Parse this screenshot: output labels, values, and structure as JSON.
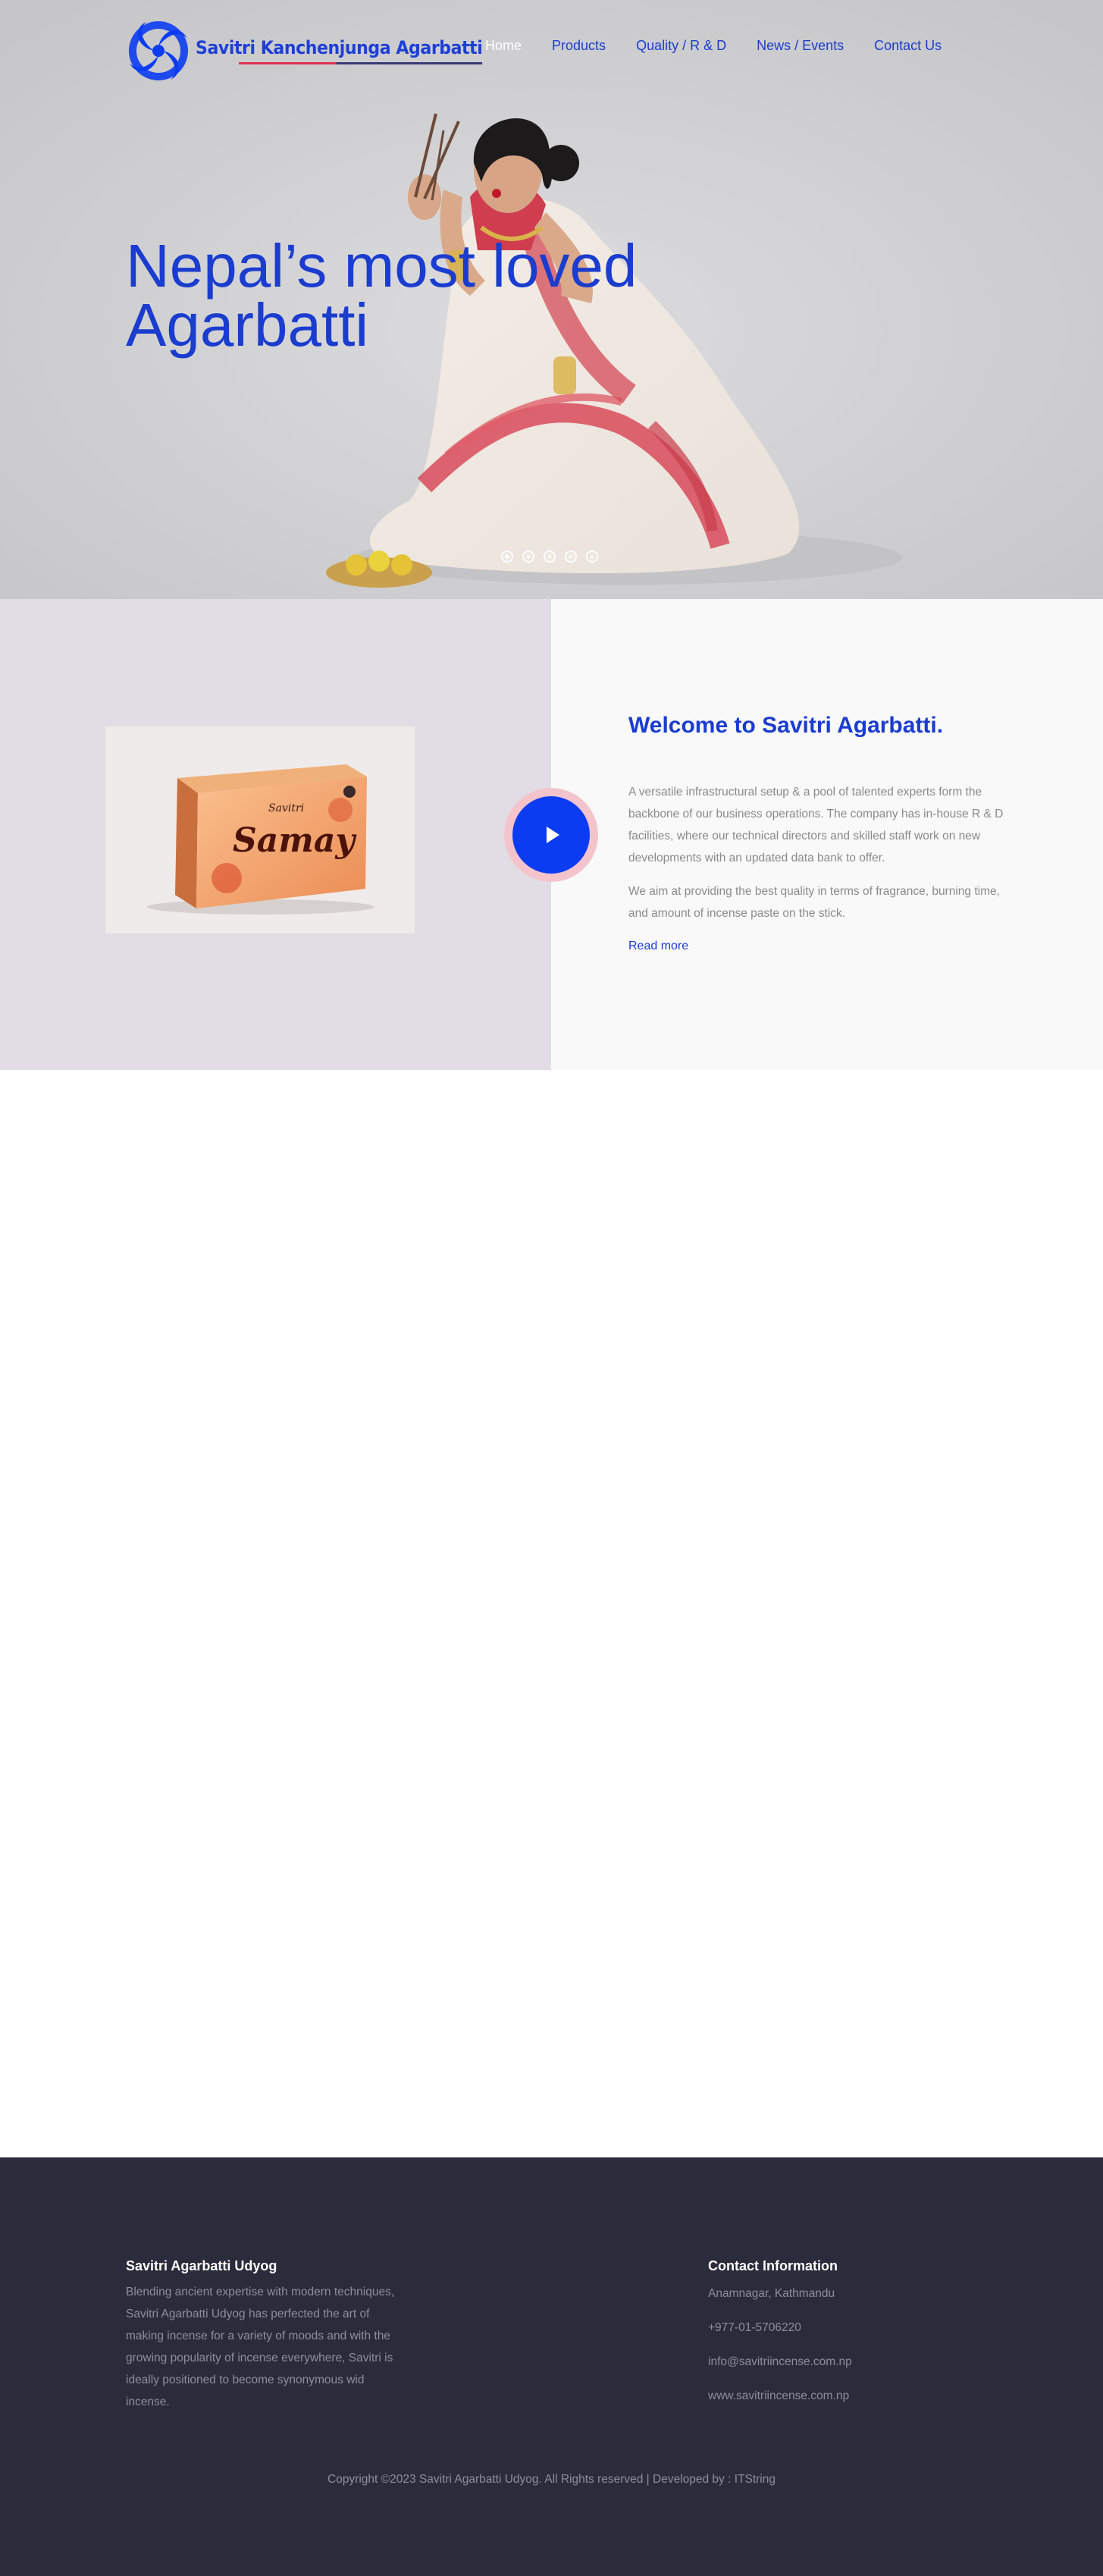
{
  "header": {
    "logo_text": "Savitri Kanchenjunga Agarbatti",
    "nav": [
      {
        "label": "Home",
        "active": true
      },
      {
        "label": "Products",
        "active": false
      },
      {
        "label": "Quality / R & D",
        "active": false
      },
      {
        "label": "News / Events",
        "active": false
      },
      {
        "label": "Contact Us",
        "active": false
      }
    ]
  },
  "hero": {
    "title_line1": "Nepal’s most loved",
    "title_line2": "Agarbatti",
    "slides": 5,
    "active_slide": 1
  },
  "welcome": {
    "product_brand": "Savitri",
    "product_name": "Samay",
    "title": "Welcome to Savitri Agarbatti.",
    "paragraph1": "A versatile infrastructural setup & a pool of talented experts form the backbone of our business operations. The company has in-house R & D facilities, where our technical directors and skilled staff work on new developments with an updated data bank to offer.",
    "paragraph2": "We aim at providing the best quality in terms of fragrance, burning time, and amount of incense paste on the stick.",
    "read_more": "Read more"
  },
  "footer": {
    "about_title": "Savitri Agarbatti Udyog",
    "about_text": "Blending ancient expertise with modern techniques, Savitri Agarbatti Udyog has perfected the art of making incense for a variety of moods and with the growing popularity of incense everywhere, Savitri is ideally positioned to become synonymous wid incense.",
    "contact_title": "Contact Information",
    "address": "Anamnagar, Kathmandu",
    "phone": "+977-01-5706220",
    "email": "info@savitriincense.com.np",
    "website": "www.savitriincense.com.np",
    "copyright": "Copyright ©2023 Savitri Agarbatti Udyog. All Rights reserved | Developed by : ITString"
  },
  "colors": {
    "brand_blue": "#1a3ccf",
    "play_blue": "#0b3cf2",
    "footer_bg": "#2b2c3b",
    "welcome_left_bg": "#e2dde4"
  }
}
